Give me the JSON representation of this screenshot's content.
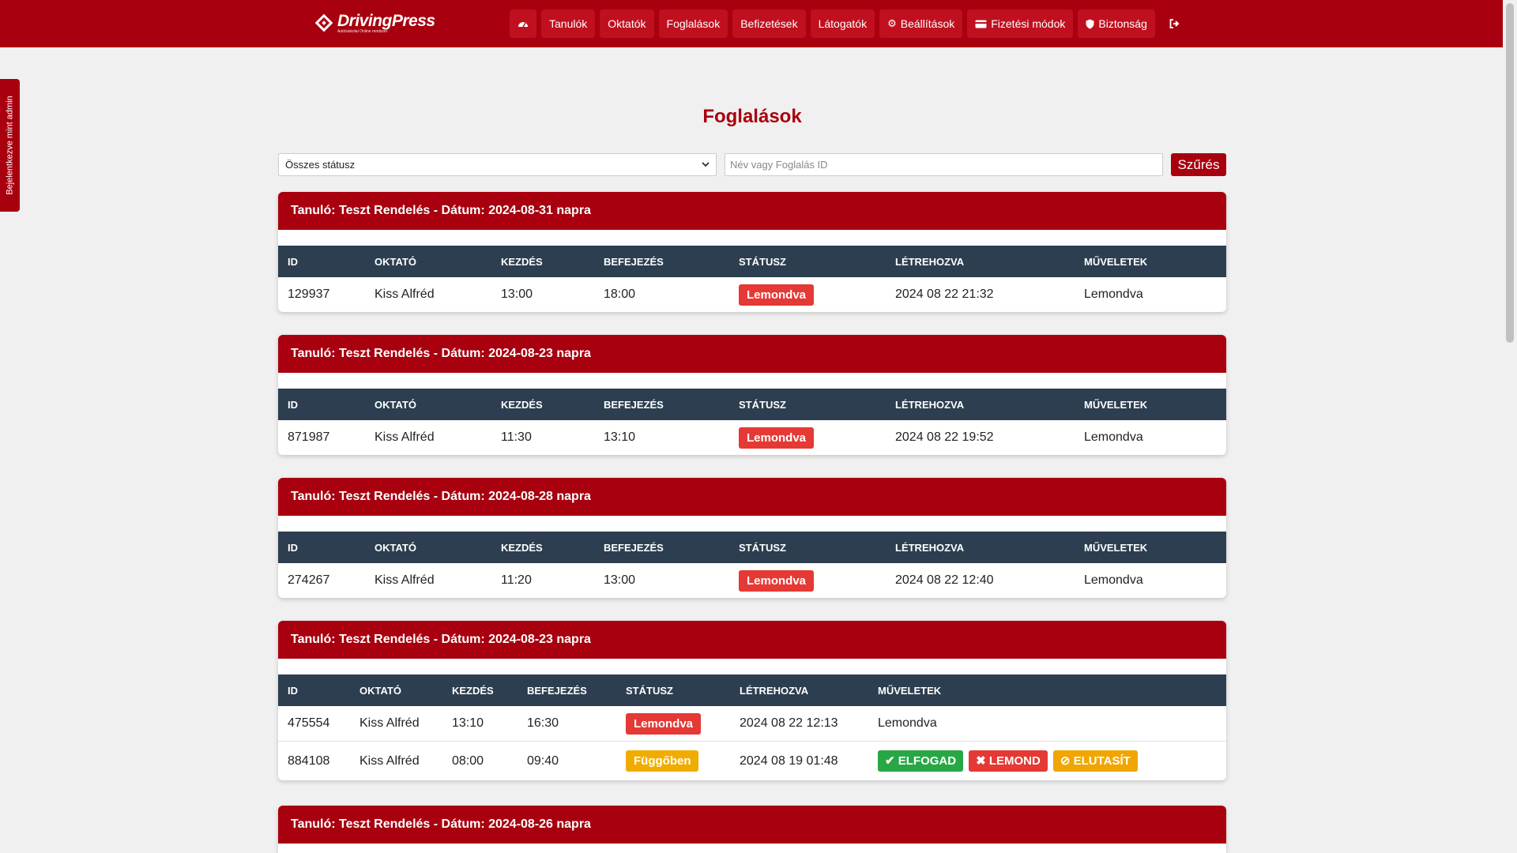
{
  "brand": {
    "name": "DrivingPress",
    "tagline": "Autósiskolai Online rendszer"
  },
  "nav": {
    "dashboard_icon": "dashboard-icon",
    "items": [
      "Tanulók",
      "Oktatók",
      "Foglalások",
      "Befizetések",
      "Látogatók",
      "Beállítások",
      "Fizetési módok",
      "Biztonság"
    ],
    "logout_icon": "logout-icon"
  },
  "side_tab": "Bejelentkezve mint admin",
  "page_title": "Foglalások",
  "filters": {
    "status_selected": "Összes státusz",
    "search_placeholder": "Név vagy Foglalás ID",
    "button": "Szűrés"
  },
  "columns": [
    "ID",
    "OKTATÓ",
    "KEZDÉS",
    "BEFEJEZÉS",
    "STÁTUSZ",
    "LÉTREHOZVA",
    "MŰVELETEK"
  ],
  "cards": [
    {
      "title": "Tanuló: Teszt Rendelés - Dátum: 2024-08-31 napra",
      "rows": [
        {
          "id": "129937",
          "instructor": "Kiss Alfréd",
          "start": "13:00",
          "end": "18:00",
          "status": "Lemondva",
          "created": "2024 08 22 21:32",
          "action": "Lemondva"
        }
      ]
    },
    {
      "title": "Tanuló: Teszt Rendelés - Dátum: 2024-08-23 napra",
      "rows": [
        {
          "id": "871987",
          "instructor": "Kiss Alfréd",
          "start": "11:30",
          "end": "13:10",
          "status": "Lemondva",
          "created": "2024 08 22 19:52",
          "action": "Lemondva"
        }
      ]
    },
    {
      "title": "Tanuló: Teszt Rendelés - Dátum: 2024-08-28 napra",
      "rows": [
        {
          "id": "274267",
          "instructor": "Kiss Alfréd",
          "start": "11:20",
          "end": "13:00",
          "status": "Lemondva",
          "created": "2024 08 22 12:40",
          "action": "Lemondva"
        }
      ]
    },
    {
      "title": "Tanuló: Teszt Rendelés - Dátum: 2024-08-23 napra",
      "rows": [
        {
          "id": "475554",
          "instructor": "Kiss Alfréd",
          "start": "13:10",
          "end": "16:30",
          "status": "Lemondva",
          "created": "2024 08 22 12:13",
          "action": "Lemondva"
        },
        {
          "id": "884108",
          "instructor": "Kiss Alfréd",
          "start": "08:00",
          "end": "09:40",
          "status": "Függőben",
          "created": "2024 08 19 01:48",
          "buttons": {
            "accept": "ELFOGAD",
            "cancel": "LEMOND",
            "reject": "ELUTASÍT"
          }
        }
      ]
    },
    {
      "title": "Tanuló: Teszt Rendelés - Dátum: 2024-08-26 napra",
      "rows": []
    }
  ],
  "colors": {
    "brand_red": "#a8000f",
    "header_dark": "#2c3e50",
    "status_cancelled": "#e53935",
    "status_pending": "#f0ad00",
    "accept_green": "#28a745"
  }
}
